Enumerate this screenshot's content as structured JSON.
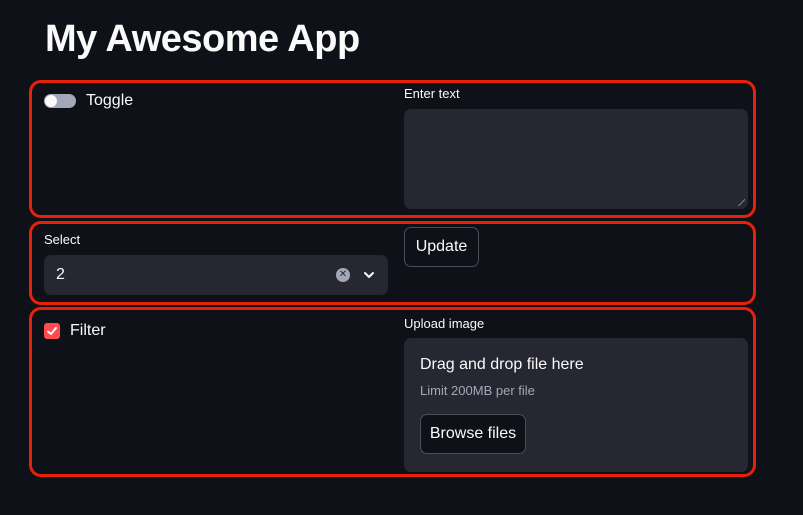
{
  "app": {
    "title": "My Awesome App"
  },
  "row1": {
    "toggle": {
      "label": "Toggle",
      "checked": false
    },
    "text_area": {
      "label": "Enter text",
      "value": ""
    }
  },
  "row2": {
    "select": {
      "label": "Select",
      "value": "2"
    },
    "update_button": {
      "label": "Update"
    }
  },
  "row3": {
    "checkbox": {
      "label": "Filter",
      "checked": true
    },
    "uploader": {
      "label": "Upload image",
      "drop_text": "Drag and drop file here",
      "limit_text": "Limit 200MB per file",
      "browse_label": "Browse files"
    }
  },
  "colors": {
    "background": "#0e1117",
    "surface": "#262730",
    "accent": "#ff4b4b",
    "highlight_border": "#e8210b"
  }
}
